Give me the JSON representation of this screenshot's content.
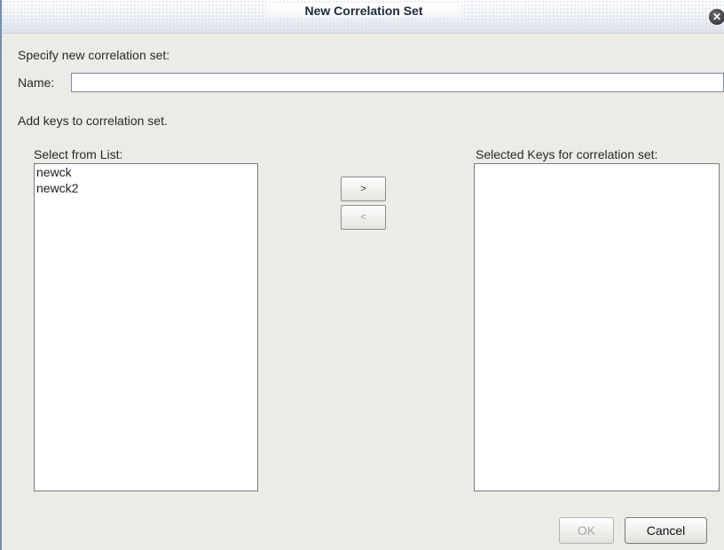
{
  "window": {
    "title": "New Correlation Set",
    "close_glyph": "✕"
  },
  "form": {
    "specify_label": "Specify new correlation set:",
    "name_label": "Name:",
    "name_value": "",
    "add_keys_label": "Add keys to correlation set."
  },
  "available": {
    "label": "Select from List:",
    "items": [
      "newck",
      "newck2"
    ]
  },
  "selected": {
    "label": "Selected Keys for correlation set:",
    "items": []
  },
  "move_buttons": {
    "add_label": ">",
    "remove_label": "<"
  },
  "footer": {
    "ok_label": "OK",
    "cancel_label": "Cancel"
  }
}
